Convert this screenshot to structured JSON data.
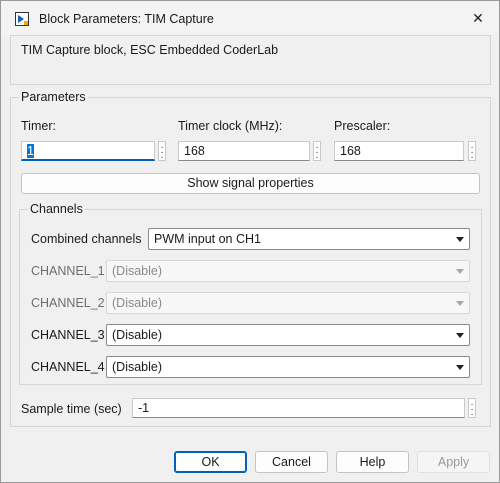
{
  "window": {
    "title": "Block Parameters: TIM Capture"
  },
  "description": "TIM Capture block, ESC Embedded CoderLab",
  "parameters": {
    "legend": "Parameters",
    "timer": {
      "label": "Timer:",
      "value": "1"
    },
    "timer_clock": {
      "label": "Timer clock (MHz):",
      "value": "168"
    },
    "prescaler": {
      "label": "Prescaler:",
      "value": "168"
    },
    "show_signal_button": "Show signal properties",
    "channels": {
      "legend": "Channels",
      "combined": {
        "label": "Combined channels",
        "value": "PWM input on CH1"
      },
      "rows": [
        {
          "label": "CHANNEL_1",
          "value": "(Disable)"
        },
        {
          "label": "CHANNEL_2",
          "value": "(Disable)"
        },
        {
          "label": "CHANNEL_3",
          "value": "(Disable)"
        },
        {
          "label": "CHANNEL_4",
          "value": "(Disable)"
        }
      ]
    },
    "sample_time": {
      "label": "Sample time (sec)",
      "value": "-1"
    }
  },
  "buttons": {
    "ok": "OK",
    "cancel": "Cancel",
    "help": "Help",
    "apply": "Apply"
  },
  "colors": {
    "accent": "#005fb8",
    "selection": "#0078d7",
    "background": "#f0f0f0"
  },
  "icons": {
    "app": "simulink-block-icon",
    "close": "close-icon",
    "more": "more-vertical-icon",
    "dropdown": "chevron-down-icon"
  }
}
